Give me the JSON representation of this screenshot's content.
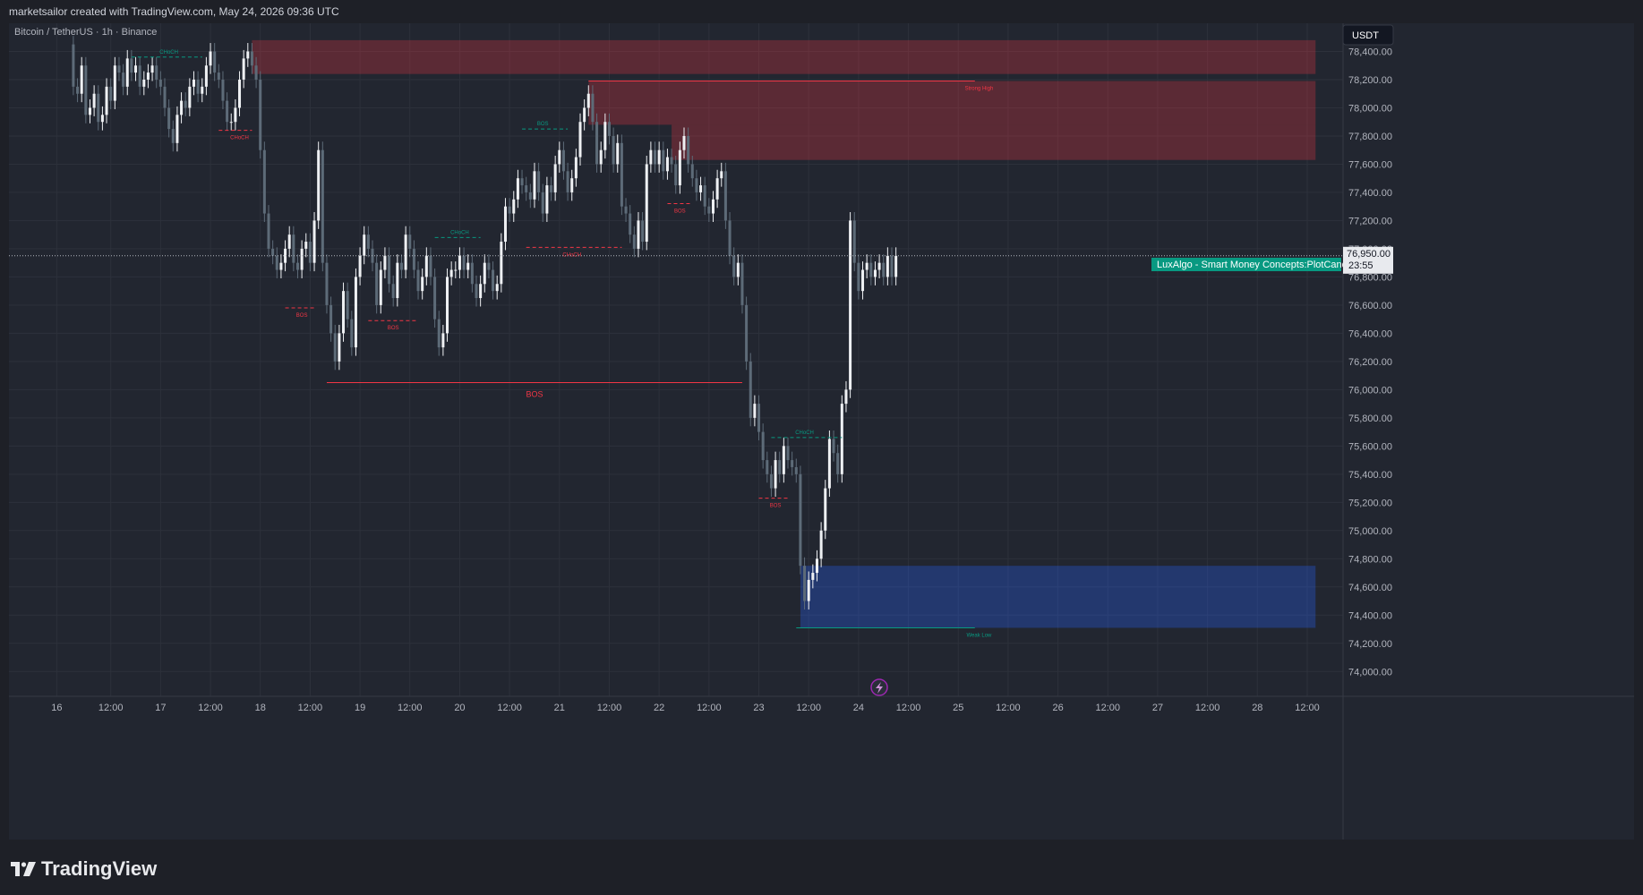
{
  "header": {
    "attribution": "marketsailor created with TradingView.com, May 24, 2026 09:36 UTC"
  },
  "chart_data": {
    "type": "candlestick",
    "symbol_title": "Bitcoin / TetherUS · 1h · Binance",
    "currency_badge": "USDT",
    "ylim": [
      73900,
      78600
    ],
    "y_ticks": [
      78400,
      78200,
      78000,
      77800,
      77600,
      77400,
      77200,
      77000,
      76800,
      76600,
      76400,
      76200,
      76000,
      75800,
      75600,
      75400,
      75200,
      75000,
      74800,
      74600,
      74400,
      74200,
      74000
    ],
    "y_tick_labels": [
      "78,400.00",
      "78,200.00",
      "78,000.00",
      "77,800.00",
      "77,600.00",
      "77,400.00",
      "77,200.00",
      "77,000.00",
      "76,800.00",
      "76,600.00",
      "76,400.00",
      "76,200.00",
      "76,000.00",
      "75,800.00",
      "75,600.00",
      "75,400.00",
      "75,200.00",
      "75,000.00",
      "74,800.00",
      "74,600.00",
      "74,400.00",
      "74,200.00",
      "74,000.00"
    ],
    "x_ticks": [
      {
        "t": -1,
        "label": "16"
      },
      {
        "t": 12,
        "label": "12:00"
      },
      {
        "t": 24,
        "label": "17"
      },
      {
        "t": 36,
        "label": "12:00"
      },
      {
        "t": 48,
        "label": "18"
      },
      {
        "t": 60,
        "label": "12:00"
      },
      {
        "t": 72,
        "label": "19"
      },
      {
        "t": 84,
        "label": "12:00"
      },
      {
        "t": 96,
        "label": "20"
      },
      {
        "t": 108,
        "label": "12:00"
      },
      {
        "t": 120,
        "label": "21"
      },
      {
        "t": 132,
        "label": "12:00"
      },
      {
        "t": 144,
        "label": "22"
      },
      {
        "t": 156,
        "label": "12:00"
      },
      {
        "t": 168,
        "label": "23"
      },
      {
        "t": 180,
        "label": "12:00"
      },
      {
        "t": 192,
        "label": "24"
      },
      {
        "t": 204,
        "label": "12:00"
      },
      {
        "t": 216,
        "label": "25"
      },
      {
        "t": 228,
        "label": "12:00"
      },
      {
        "t": 240,
        "label": "26"
      },
      {
        "t": 252,
        "label": "12:00"
      },
      {
        "t": 264,
        "label": "27"
      },
      {
        "t": 276,
        "label": "12:00"
      },
      {
        "t": 288,
        "label": "28"
      },
      {
        "t": 300,
        "label": "12:00"
      }
    ],
    "x_unit": "hours from May 16 00:00",
    "colors": {
      "up": "#eef0f3",
      "down": "#5d6b78",
      "bearish": "#f23645",
      "bullish": "#089981",
      "supply_zone": "rgba(242,54,69,0.28)",
      "demand_zone": "rgba(41,98,255,0.30)",
      "grid": "#2d313b",
      "badge_bg": "#e8eaee"
    },
    "close_series": [
      [
        2,
        78450
      ],
      [
        3,
        78150
      ],
      [
        4,
        78100
      ],
      [
        5,
        78300
      ],
      [
        6,
        77950
      ],
      [
        7,
        78000
      ],
      [
        8,
        78100
      ],
      [
        9,
        77900
      ],
      [
        10,
        77950
      ],
      [
        11,
        78150
      ],
      [
        12,
        78050
      ],
      [
        13,
        78300
      ],
      [
        14,
        78250
      ],
      [
        15,
        78150
      ],
      [
        16,
        78350
      ],
      [
        17,
        78250
      ],
      [
        18,
        78300
      ],
      [
        19,
        78150
      ],
      [
        20,
        78200
      ],
      [
        21,
        78250
      ],
      [
        22,
        78300
      ],
      [
        23,
        78200
      ],
      [
        24,
        78150
      ],
      [
        25,
        78000
      ],
      [
        26,
        77850
      ],
      [
        27,
        77750
      ],
      [
        28,
        77950
      ],
      [
        29,
        78050
      ],
      [
        30,
        78000
      ],
      [
        31,
        78150
      ],
      [
        32,
        78200
      ],
      [
        33,
        78100
      ],
      [
        34,
        78150
      ],
      [
        35,
        78300
      ],
      [
        36,
        78400
      ],
      [
        37,
        78250
      ],
      [
        38,
        78200
      ],
      [
        39,
        78050
      ],
      [
        40,
        77900
      ],
      [
        41,
        77900
      ],
      [
        42,
        78000
      ],
      [
        43,
        78200
      ],
      [
        44,
        78350
      ],
      [
        45,
        78400
      ],
      [
        46,
        78300
      ],
      [
        47,
        78200
      ],
      [
        48,
        77700
      ],
      [
        49,
        77250
      ],
      [
        50,
        77000
      ],
      [
        51,
        76950
      ],
      [
        52,
        76850
      ],
      [
        53,
        76900
      ],
      [
        54,
        77000
      ],
      [
        55,
        77100
      ],
      [
        56,
        76900
      ],
      [
        57,
        76850
      ],
      [
        58,
        77000
      ],
      [
        59,
        77050
      ],
      [
        60,
        76900
      ],
      [
        61,
        77200
      ],
      [
        62,
        77700
      ],
      [
        63,
        76900
      ],
      [
        64,
        76600
      ],
      [
        65,
        76400
      ],
      [
        66,
        76200
      ],
      [
        67,
        76400
      ],
      [
        68,
        76700
      ],
      [
        69,
        76500
      ],
      [
        70,
        76300
      ],
      [
        71,
        76800
      ],
      [
        72,
        76950
      ],
      [
        73,
        77100
      ],
      [
        74,
        77000
      ],
      [
        75,
        76900
      ],
      [
        76,
        76600
      ],
      [
        77,
        76850
      ],
      [
        78,
        76950
      ],
      [
        79,
        76750
      ],
      [
        80,
        76650
      ],
      [
        81,
        76900
      ],
      [
        82,
        76850
      ],
      [
        83,
        77100
      ],
      [
        84,
        77000
      ],
      [
        85,
        76850
      ],
      [
        86,
        76700
      ],
      [
        87,
        76800
      ],
      [
        88,
        76950
      ],
      [
        89,
        76800
      ],
      [
        90,
        76500
      ],
      [
        91,
        76300
      ],
      [
        92,
        76400
      ],
      [
        93,
        76800
      ],
      [
        94,
        76850
      ],
      [
        95,
        76850
      ],
      [
        96,
        76950
      ],
      [
        97,
        76850
      ],
      [
        98,
        76900
      ],
      [
        99,
        76750
      ],
      [
        100,
        76650
      ],
      [
        101,
        76750
      ],
      [
        102,
        76900
      ],
      [
        103,
        76850
      ],
      [
        104,
        76700
      ],
      [
        105,
        76750
      ],
      [
        106,
        77050
      ],
      [
        107,
        77300
      ],
      [
        108,
        77250
      ],
      [
        109,
        77350
      ],
      [
        110,
        77500
      ],
      [
        111,
        77450
      ],
      [
        112,
        77400
      ],
      [
        113,
        77350
      ],
      [
        114,
        77550
      ],
      [
        115,
        77400
      ],
      [
        116,
        77250
      ],
      [
        117,
        77450
      ],
      [
        118,
        77400
      ],
      [
        119,
        77600
      ],
      [
        120,
        77700
      ],
      [
        121,
        77550
      ],
      [
        122,
        77400
      ],
      [
        123,
        77500
      ],
      [
        124,
        77650
      ],
      [
        125,
        77900
      ],
      [
        126,
        78000
      ],
      [
        127,
        78100
      ],
      [
        128,
        77900
      ],
      [
        129,
        77600
      ],
      [
        130,
        77700
      ],
      [
        131,
        77900
      ],
      [
        132,
        77800
      ],
      [
        133,
        77600
      ],
      [
        134,
        77750
      ],
      [
        135,
        77300
      ],
      [
        136,
        77250
      ],
      [
        137,
        77100
      ],
      [
        138,
        77000
      ],
      [
        139,
        77200
      ],
      [
        140,
        77050
      ],
      [
        141,
        77600
      ],
      [
        142,
        77700
      ],
      [
        143,
        77600
      ],
      [
        144,
        77700
      ],
      [
        145,
        77550
      ],
      [
        146,
        77650
      ],
      [
        147,
        77600
      ],
      [
        148,
        77450
      ],
      [
        149,
        77700
      ],
      [
        150,
        77800
      ],
      [
        151,
        77600
      ],
      [
        152,
        77500
      ],
      [
        153,
        77400
      ],
      [
        154,
        77450
      ],
      [
        155,
        77300
      ],
      [
        156,
        77250
      ],
      [
        157,
        77350
      ],
      [
        158,
        77500
      ],
      [
        159,
        77550
      ],
      [
        160,
        77200
      ],
      [
        161,
        76950
      ],
      [
        162,
        76800
      ],
      [
        163,
        76900
      ],
      [
        164,
        76600
      ],
      [
        165,
        76200
      ],
      [
        166,
        75800
      ],
      [
        167,
        75900
      ],
      [
        168,
        75700
      ],
      [
        169,
        75500
      ],
      [
        170,
        75400
      ],
      [
        171,
        75300
      ],
      [
        172,
        75500
      ],
      [
        173,
        75400
      ],
      [
        174,
        75600
      ],
      [
        175,
        75500
      ],
      [
        176,
        75450
      ],
      [
        177,
        75400
      ],
      [
        178,
        74750
      ],
      [
        179,
        74500
      ],
      [
        180,
        74650
      ],
      [
        181,
        74700
      ],
      [
        182,
        74800
      ],
      [
        183,
        75000
      ],
      [
        184,
        75300
      ],
      [
        185,
        75650
      ],
      [
        186,
        75550
      ],
      [
        187,
        75400
      ],
      [
        188,
        75900
      ],
      [
        189,
        76000
      ],
      [
        190,
        77200
      ],
      [
        191,
        76900
      ],
      [
        192,
        76700
      ],
      [
        193,
        76850
      ],
      [
        194,
        76900
      ],
      [
        195,
        76800
      ],
      [
        196,
        76850
      ],
      [
        197,
        76900
      ],
      [
        198,
        76800
      ],
      [
        199,
        76950
      ],
      [
        200,
        76800
      ],
      [
        201,
        76950
      ]
    ],
    "last_price": 76950,
    "last_price_label": "76,950.00",
    "countdown_label": "23:55",
    "indicator_label": "LuxAlgo - Smart Money Concepts:PlotCandle",
    "zones": [
      {
        "kind": "supply",
        "t1": 46,
        "t2": 302,
        "top": 78480,
        "bottom": 78240
      },
      {
        "kind": "supply",
        "t1": 127,
        "t2": 302,
        "top": 78190,
        "bottom": 77880
      },
      {
        "kind": "supply",
        "t1": 147,
        "t2": 302,
        "top": 77880,
        "bottom": 77630
      },
      {
        "kind": "demand",
        "t1": 178,
        "t2": 302,
        "top": 74750,
        "bottom": 74310
      }
    ],
    "structure": [
      {
        "label": "CHoCH",
        "kind": "bullish",
        "t1": 17,
        "t2": 34,
        "price": 78360,
        "style": "dashed",
        "label_t": 26
      },
      {
        "label": "CHoCH",
        "kind": "bearish",
        "t1": 38,
        "t2": 46,
        "price": 77840,
        "style": "dashed",
        "label_t": 43
      },
      {
        "label": "BOS",
        "kind": "bearish",
        "t1": 54,
        "t2": 61,
        "price": 76580,
        "style": "dashed",
        "label_t": 58
      },
      {
        "label": "BOS",
        "kind": "bearish",
        "t1": 74,
        "t2": 86,
        "price": 76490,
        "style": "dashed",
        "label_t": 80
      },
      {
        "label": "CHoCH",
        "kind": "bullish",
        "t1": 90,
        "t2": 101,
        "price": 77080,
        "style": "dashed",
        "label_t": 96
      },
      {
        "label": "BOS",
        "kind": "bearish",
        "t1": 64,
        "t2": 164,
        "price": 76050,
        "style": "solid",
        "label_t": 114,
        "big": true
      },
      {
        "label": "BOS",
        "kind": "bullish",
        "t1": 111,
        "t2": 122,
        "price": 77850,
        "style": "dashed",
        "label_t": 116
      },
      {
        "label": "CHoCH",
        "kind": "bearish",
        "t1": 112,
        "t2": 135,
        "price": 77010,
        "style": "dashed",
        "label_t": 123
      },
      {
        "label": "BOS",
        "kind": "bearish",
        "t1": 146,
        "t2": 152,
        "price": 77320,
        "style": "dashed",
        "label_t": 149
      },
      {
        "label": "CHoCH",
        "kind": "bullish",
        "t1": 171,
        "t2": 188,
        "price": 75660,
        "style": "dashed",
        "label_t": 179
      },
      {
        "label": "BOS",
        "kind": "bearish",
        "t1": 168,
        "t2": 175,
        "price": 75230,
        "style": "dashed",
        "label_t": 172
      },
      {
        "label": "Strong High",
        "kind": "bearish",
        "t1": 127,
        "t2": 220,
        "price": 78190,
        "style": "solid",
        "label_t": 221
      },
      {
        "label": "Weak Low",
        "kind": "bullish",
        "t1": 177,
        "t2": 220,
        "price": 74310,
        "style": "solid",
        "label_t": 221
      }
    ]
  },
  "footer": {
    "brand": "TradingView"
  }
}
